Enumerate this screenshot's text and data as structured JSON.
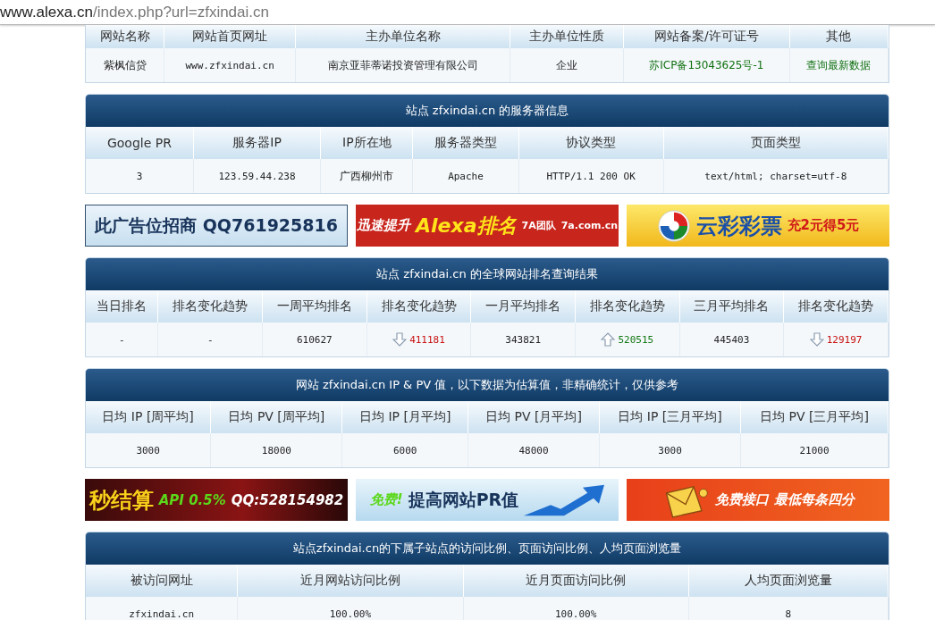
{
  "address_bar": {
    "host": "www.alexa.cn",
    "path": "/index.php?url=zfxindai.cn"
  },
  "sections": [
    {
      "kind": "table",
      "columns": [
        "网站名称",
        "网站首页网址",
        "主办单位名称",
        "主办单位性质",
        "网站备案/许可证号",
        "其他"
      ],
      "rows": [
        [
          {
            "kind": "text",
            "text": "紫枫信贷"
          },
          {
            "kind": "mono",
            "text": "www.zfxindai.cn"
          },
          {
            "kind": "text",
            "text": "南京亚菲蒂诺投资管理有限公司"
          },
          {
            "kind": "text",
            "text": "企业"
          },
          {
            "kind": "green",
            "text": "苏ICP备13043625号-1"
          },
          {
            "kind": "link",
            "text": "查询最新数据"
          }
        ]
      ]
    },
    {
      "kind": "table",
      "title": "站点 zfxindai.cn 的服务器信息",
      "columns": [
        "Google PR",
        "服务器IP",
        "IP所在地",
        "服务器类型",
        "协议类型",
        "页面类型"
      ],
      "rows": [
        [
          {
            "kind": "mono",
            "text": "3"
          },
          {
            "kind": "mono",
            "text": "123.59.44.238"
          },
          {
            "kind": "text",
            "text": "广西柳州市"
          },
          {
            "kind": "mono",
            "text": "Apache"
          },
          {
            "kind": "mono",
            "text": "HTTP/1.1 200 OK"
          },
          {
            "kind": "mono",
            "text": "text/html; charset=utf-8"
          }
        ]
      ]
    },
    {
      "kind": "ads",
      "ads": [
        {
          "kind": "plain",
          "parts": [
            {
              "kind": "navy",
              "text": "此广告位招商 QQ761925816"
            }
          ]
        },
        {
          "kind": "red",
          "parts": [
            {
              "kind": "white",
              "text": "迅速提升"
            },
            {
              "kind": "yellow",
              "text": "Alexa排名"
            },
            {
              "kind": "small",
              "text": "7A团队"
            },
            {
              "kind": "small",
              "text": "7a.com.cn"
            }
          ]
        },
        {
          "kind": "gold",
          "parts": [
            {
              "kind": "logo"
            },
            {
              "kind": "blue",
              "text": "云彩彩票"
            },
            {
              "kind": "red",
              "text": "充2元得5元"
            }
          ]
        }
      ]
    },
    {
      "kind": "table",
      "title": "站点 zfxindai.cn 的全球网站排名查询结果",
      "columns": [
        "当日排名",
        "排名变化趋势",
        "一周平均排名",
        "排名变化趋势",
        "一月平均排名",
        "排名变化趋势",
        "三月平均排名",
        "排名变化趋势"
      ],
      "rows": [
        [
          {
            "kind": "mono",
            "text": "-"
          },
          {
            "kind": "mono",
            "text": "-"
          },
          {
            "kind": "mono",
            "text": "610627"
          },
          {
            "kind": "trend",
            "rising": false,
            "text": "411181"
          },
          {
            "kind": "mono",
            "text": "343821"
          },
          {
            "kind": "trend",
            "rising": true,
            "text": "520515"
          },
          {
            "kind": "mono",
            "text": "445403"
          },
          {
            "kind": "trend",
            "rising": false,
            "text": "129197"
          }
        ]
      ]
    },
    {
      "kind": "table",
      "title": "网站 zfxindai.cn IP & PV 值，以下数据为估算值，非精确统计，仅供参考",
      "columns": [
        "日均 IP [周平均]",
        "日均 PV [周平均]",
        "日均 IP [月平均]",
        "日均 PV [月平均]",
        "日均 IP [三月平均]",
        "日均 PV [三月平均]"
      ],
      "rows": [
        [
          {
            "kind": "mono",
            "text": "3000"
          },
          {
            "kind": "mono",
            "text": "18000"
          },
          {
            "kind": "mono",
            "text": "6000"
          },
          {
            "kind": "mono",
            "text": "48000"
          },
          {
            "kind": "mono",
            "text": "3000"
          },
          {
            "kind": "mono",
            "text": "21000"
          }
        ]
      ]
    },
    {
      "kind": "ads",
      "ads": [
        {
          "kind": "dark",
          "parts": [
            {
              "kind": "bigyellow",
              "text": "秒结算"
            },
            {
              "kind": "green",
              "text": "API 0.5%"
            },
            {
              "kind": "white",
              "text": "QQ:528154982"
            }
          ]
        },
        {
          "kind": "sky",
          "parts": [
            {
              "kind": "green",
              "text": "免费!"
            },
            {
              "kind": "navy",
              "text": "提高网站PR值"
            },
            {
              "kind": "arrow"
            }
          ]
        },
        {
          "kind": "orange",
          "parts": [
            {
              "kind": "cartoon"
            },
            {
              "kind": "white",
              "text": "免费接口"
            },
            {
              "kind": "white",
              "text": "最低每条四分"
            }
          ]
        }
      ]
    },
    {
      "kind": "table",
      "title": "站点zfxindai.cn的下属子站点的访问比例、页面访问比例、人均页面浏览量",
      "columns": [
        "被访问网址",
        "近月网站访问比例",
        "近月页面访问比例",
        "人均页面浏览量"
      ],
      "rows": [
        [
          {
            "kind": "mono",
            "text": "zfxindai.cn"
          },
          {
            "kind": "mono",
            "text": "100.00%"
          },
          {
            "kind": "mono",
            "text": "100.00%"
          },
          {
            "kind": "mono",
            "text": "8"
          }
        ]
      ]
    }
  ]
}
